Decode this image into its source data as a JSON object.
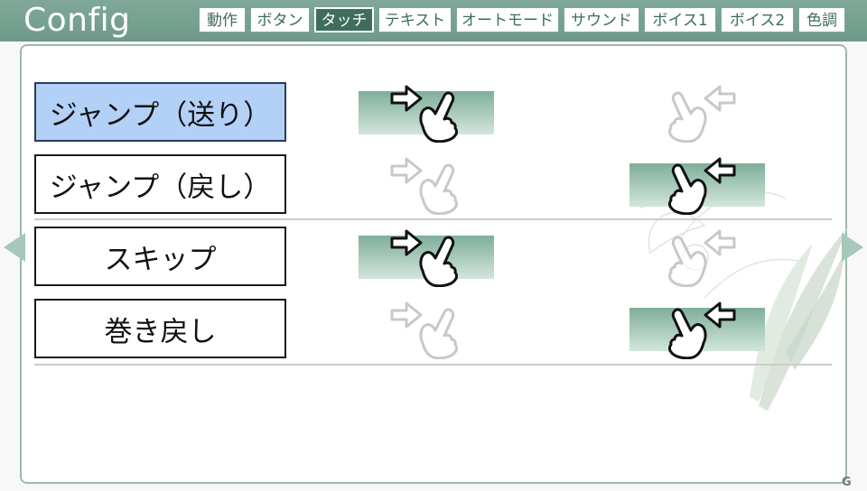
{
  "header": {
    "title": "Config",
    "tabs": [
      {
        "label": "動作",
        "active": false
      },
      {
        "label": "ボタン",
        "active": false
      },
      {
        "label": "タッチ",
        "active": true
      },
      {
        "label": "テキスト",
        "active": false
      },
      {
        "label": "オートモード",
        "active": false
      },
      {
        "label": "サウンド",
        "active": false
      },
      {
        "label": "ボイス1",
        "active": false
      },
      {
        "label": "ボイス2",
        "active": false
      },
      {
        "label": "色調",
        "active": false
      }
    ]
  },
  "actions": [
    {
      "label": "ジャンプ（送り）",
      "selected": true,
      "gesture": "right"
    },
    {
      "label": "ジャンプ（戻し）",
      "selected": false,
      "gesture": "left"
    },
    {
      "label": "スキップ",
      "selected": false,
      "gesture": "right"
    },
    {
      "label": "巻き戻し",
      "selected": false,
      "gesture": "left"
    }
  ],
  "gestures": {
    "right": "swipe-right-icon",
    "left": "swipe-left-icon"
  },
  "nav": {
    "prev": "triangle-left-icon",
    "next": "triangle-right-icon"
  },
  "watermark": "G",
  "colors": {
    "header": "#7fa898",
    "active_tab": "#3e6d5d",
    "selected_action": "#b3d1f7",
    "active_gesture_top": "#7fae9a",
    "active_gesture_bottom": "#d2e6dc"
  }
}
